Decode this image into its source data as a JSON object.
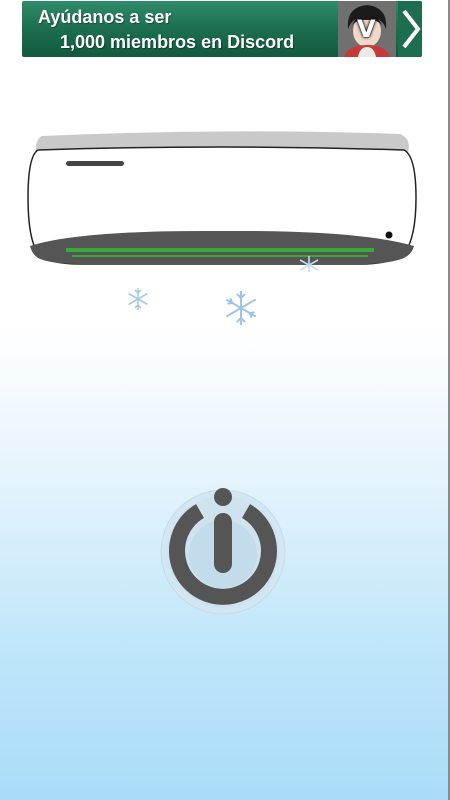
{
  "banner": {
    "line1": "Ayúdanos a ser",
    "line2": "1,000 miembros en Discord",
    "avatar_letter": "V",
    "arrow_icon": "chevron-right-icon",
    "background_color": "#1c6e4f"
  },
  "air_conditioner": {
    "indicator_color": "#3aa83a",
    "status_led_color": "#111111"
  },
  "snowflakes": [
    "snowflake-icon",
    "snowflake-icon",
    "snowflake-icon"
  ],
  "power_button": {
    "icon": "power-icon",
    "ring_color": "#555555",
    "accent_color": "#a9dcf8"
  }
}
